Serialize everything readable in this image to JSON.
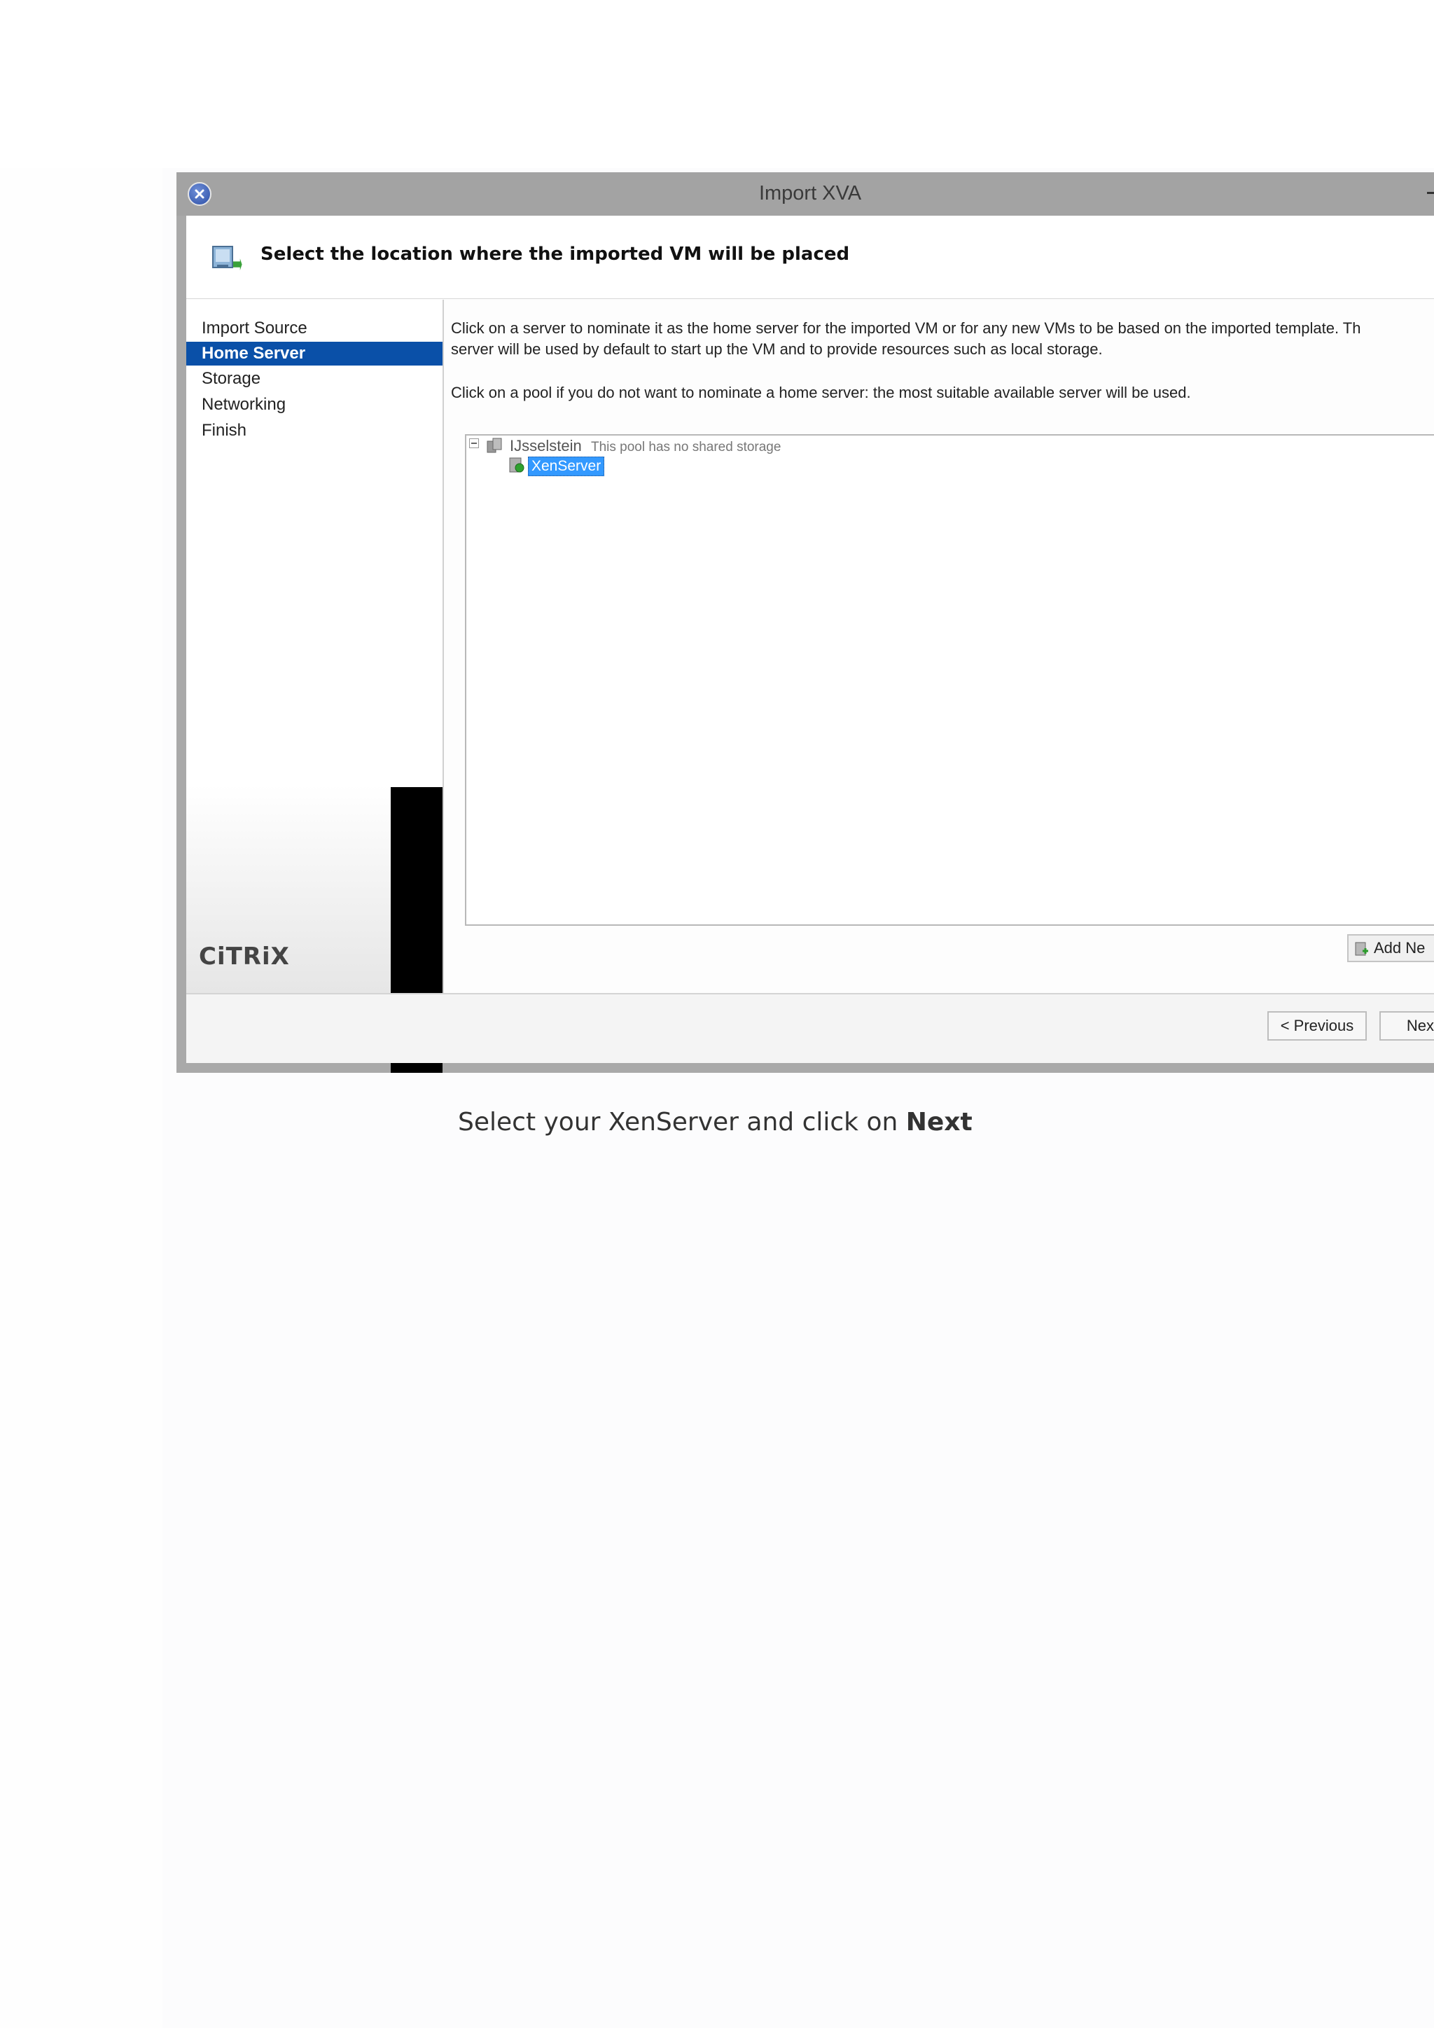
{
  "window": {
    "title": "Import XVA"
  },
  "header": {
    "title": "Select the location where the imported VM will be placed"
  },
  "steps": [
    {
      "label": "Import Source",
      "active": false
    },
    {
      "label": "Home Server",
      "active": true
    },
    {
      "label": "Storage",
      "active": false
    },
    {
      "label": "Networking",
      "active": false
    },
    {
      "label": "Finish",
      "active": false
    }
  ],
  "branding": {
    "logo_text": "CiTRiX"
  },
  "content": {
    "description_line1": "Click on a server to nominate it as the home server for the imported VM or for any new VMs to be based on the imported template. Th",
    "description_line2": "server will be used by default to start up the VM and to provide resources such as local storage.",
    "description_line3": "Click on a pool if you do not want to nominate a home server: the most suitable available server will be used.",
    "tree": {
      "pool_name": "IJsselstein",
      "pool_note": "This pool has no shared storage",
      "server_name": "XenServer"
    },
    "add_new_label": "Add Ne"
  },
  "footer": {
    "previous_label": "< Previous",
    "next_label": "Next >"
  },
  "caption": {
    "text": "Select your XenServer and click on ",
    "emphasis": "Next"
  },
  "colors": {
    "selection_blue": "#0a50a8",
    "tree_selection": "#3399ff",
    "titlebar": "#a3a3a3"
  }
}
